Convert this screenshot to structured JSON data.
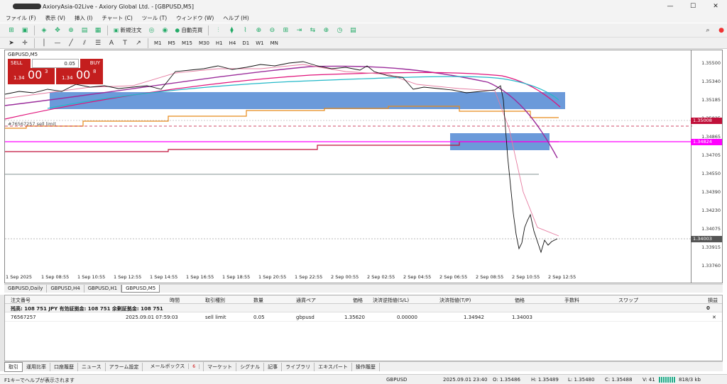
{
  "window": {
    "title": "AxioryAsia-02Live - Axiory Global Ltd. - [GBPUSD,M5]",
    "min": "—",
    "max": "☐",
    "close": "✕"
  },
  "menu": [
    "ファイル (F)",
    "表示 (V)",
    "挿入 (I)",
    "チャート (C)",
    "ツール (T)",
    "ウィンドウ (W)",
    "ヘルプ (H)"
  ],
  "toolbar": {
    "new_order": "新規注文",
    "auto_trade": "自動売買"
  },
  "timeframes": [
    "M1",
    "M5",
    "M15",
    "M30",
    "H1",
    "H4",
    "D1",
    "W1",
    "MN"
  ],
  "chart": {
    "symbol": "GBPUSD,M5",
    "sell_label": "SELL",
    "buy_label": "BUY",
    "lot": "0.05",
    "sell_small": "1.34",
    "sell_big": "00",
    "sell_sup": "3",
    "buy_small": "1.34",
    "buy_big": "00",
    "buy_sup": "8",
    "order_label": "#76567257 sell limit",
    "price_ticks": [
      "1.35500",
      "1.35340",
      "1.35185",
      "1.35025",
      "1.34865",
      "1.34705",
      "1.34550",
      "1.34390",
      "1.34230",
      "1.34075",
      "1.33915",
      "1.33760"
    ],
    "tag_high": "1.35008",
    "tag_mid": "1.34824",
    "tag_low": "1.34003",
    "time_ticks": [
      "1 Sep 2025",
      "1 Sep 08:55",
      "1 Sep 10:55",
      "1 Sep 12:55",
      "1 Sep 14:55",
      "1 Sep 16:55",
      "1 Sep 18:55",
      "1 Sep 20:55",
      "1 Sep 22:55",
      "2 Sep 00:55",
      "2 Sep 02:55",
      "2 Sep 04:55",
      "2 Sep 06:55",
      "2 Sep 08:55",
      "2 Sep 10:55",
      "2 Sep 12:55"
    ],
    "colors": {
      "zone": "#5b8fd6",
      "ma_fast": "#e57ba0",
      "ma_slow": "#9b2d9b",
      "ma_teal": "#22b8c8",
      "level_orange": "#e88a1a",
      "level_magenta": "#ff00ff",
      "level_crimson": "#c0103a"
    }
  },
  "chart_tabs": [
    "GBPUSD,Daily",
    "GBPUSD,H4",
    "GBPUSD,H1",
    "GBPUSD,M5"
  ],
  "terminal": {
    "headers": [
      "注文番号",
      "時間",
      "取引種別",
      "数量",
      "通貨ペア",
      "価格",
      "決済逆指値(S/L)",
      "決済指値(T/P)",
      "価格",
      "手数料",
      "スワップ",
      "損益"
    ],
    "balance": "残高: 108 751 JPY  有効証拠金: 108 751  余剰証拠金: 108 751",
    "balance_pl": "0",
    "order": {
      "ticket": "76567257",
      "time": "2025.09.01 07:59:03",
      "type": "sell limit",
      "volume": "0.05",
      "symbol": "gbpusd",
      "price": "1.35620",
      "sl": "0.00000",
      "tp": "1.34942",
      "cur": "1.34003",
      "close": "✕"
    }
  },
  "bottom_tabs": [
    "取引",
    "運用比率",
    "口座履歴",
    "ニュース",
    "アラーム設定",
    "メールボックス",
    "マーケット",
    "シグナル",
    "記事",
    "ライブラリ",
    "エキスパート",
    "操作履歴"
  ],
  "mailbox_count": "6",
  "status": {
    "help": "F1キーでヘルプが表示されます",
    "symbol": "GBPUSD",
    "datetime": "2025.09.01 23:40",
    "o": "O: 1.35486",
    "h": "H: 1.35489",
    "l": "L: 1.35480",
    "c": "C: 1.35488",
    "v": "V: 41",
    "traffic": "818/3 kb"
  }
}
